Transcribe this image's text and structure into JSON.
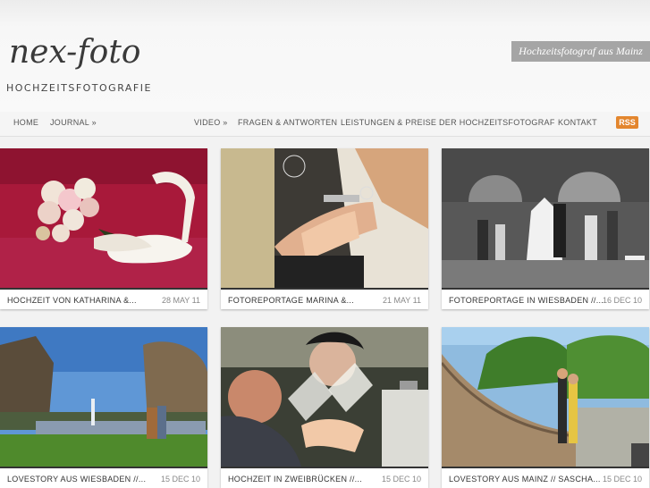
{
  "site": {
    "logo_script": "nex-foto",
    "logo_subtitle": "HOCHZEITSFOTOGRAFIE",
    "tagline": "Hochzeitsfotograf aus Mainz"
  },
  "nav": {
    "home": "HOME",
    "journal": "JOURNAL »",
    "video": "VIDEO »",
    "faq": "FRAGEN & ANTWORTEN",
    "services": "LEISTUNGEN & PREISE",
    "photographer": "DER HOCHZEITSFOTOGRAF",
    "contact": "KONTAKT",
    "rss": "RSS"
  },
  "posts": [
    {
      "title": "HOCHZEIT VON KATHARINA &...",
      "date": "28 MAY 11"
    },
    {
      "title": "FOTOREPORTAGE MARINA &...",
      "date": "21 MAY 11"
    },
    {
      "title": "FOTOREPORTAGE IN WIESBADEN //...",
      "date": "16 DEC 10"
    },
    {
      "title": "LOVESTORY AUS WIESBADEN //...",
      "date": "15 DEC 10"
    },
    {
      "title": "HOCHZEIT IN ZWEIBRÜCKEN //...",
      "date": "15 DEC 10"
    },
    {
      "title": "LOVESTORY AUS MAINZ // SASCHA...",
      "date": "15 DEC 10"
    }
  ],
  "colors": {
    "accent_rss": "#e3862e",
    "tagline_bg": "#a5a5a5",
    "caption_rule": "#333333"
  }
}
